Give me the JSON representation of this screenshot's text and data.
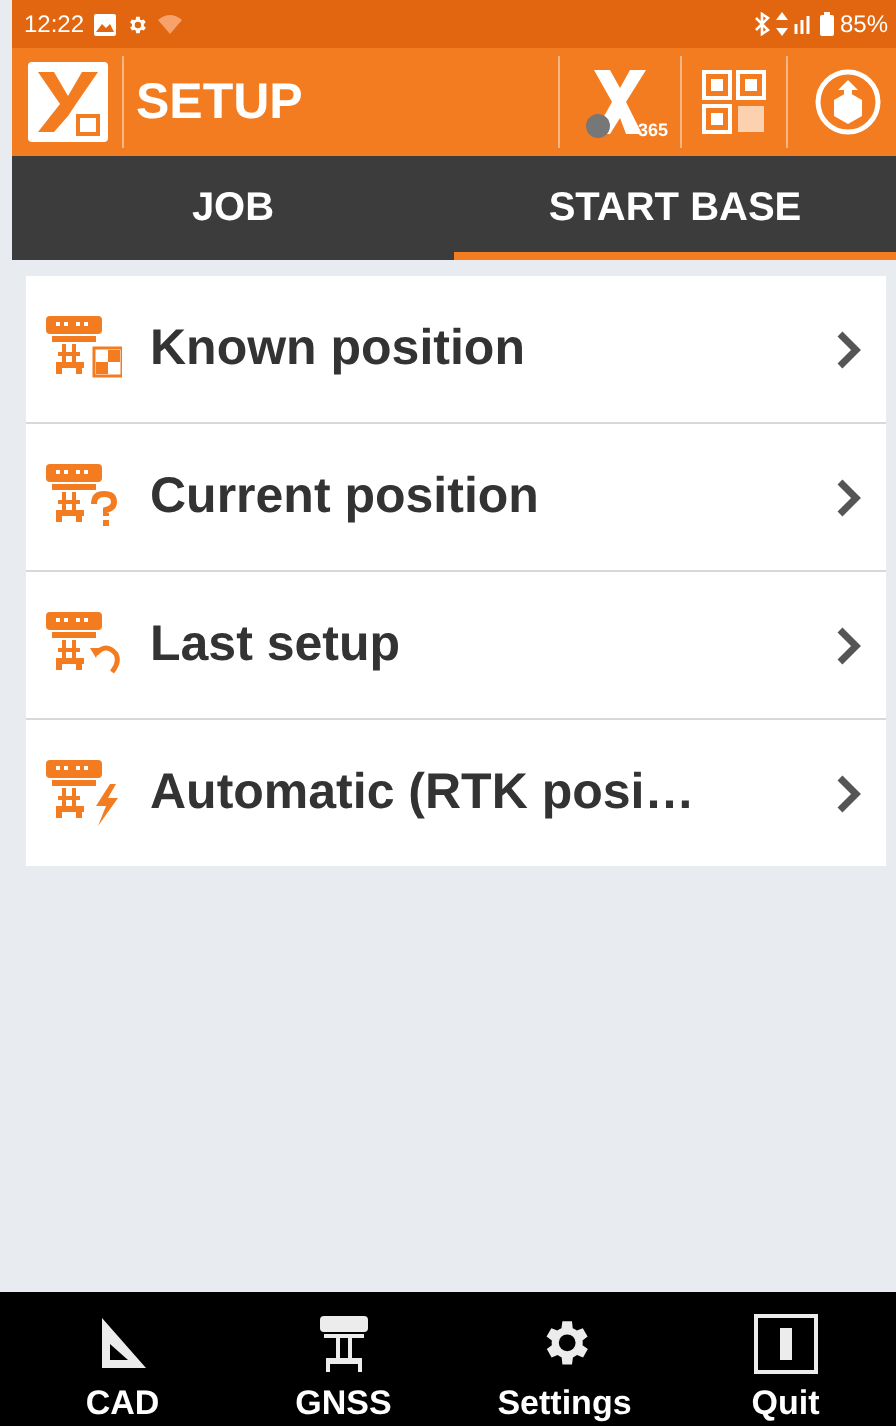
{
  "status_bar": {
    "time": "12:22",
    "battery": "85%"
  },
  "app_bar": {
    "title": "SETUP",
    "badge": "365"
  },
  "tabs": [
    {
      "label": "JOB",
      "selected": false
    },
    {
      "label": "START BASE",
      "selected": true
    }
  ],
  "items": [
    {
      "kind": "known",
      "label": "Known position"
    },
    {
      "kind": "current",
      "label": "Current position"
    },
    {
      "kind": "last",
      "label": "Last setup"
    },
    {
      "kind": "auto",
      "label": "Automatic (RTK posi…"
    }
  ],
  "nav": [
    {
      "kind": "cad",
      "label": "CAD"
    },
    {
      "kind": "gnss",
      "label": "GNSS"
    },
    {
      "kind": "settings",
      "label": "Settings"
    },
    {
      "kind": "quit",
      "label": "Quit"
    }
  ]
}
